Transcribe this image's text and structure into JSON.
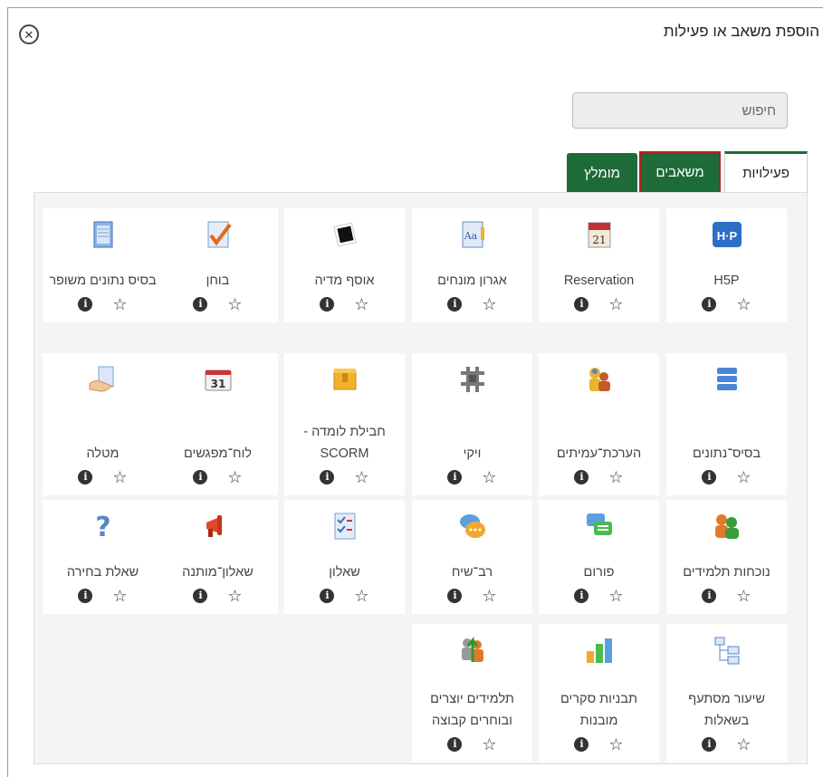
{
  "dialog": {
    "title": "הוספת משאב או פעילות",
    "close_glyph": "✕"
  },
  "search": {
    "placeholder": "חיפוש"
  },
  "tabs": [
    {
      "label": "פעילויות",
      "active": true
    },
    {
      "label": "משאבים",
      "highlighted": true
    },
    {
      "label": "מומלץ"
    }
  ],
  "items": [
    {
      "label": "H5P",
      "icon": "h5p-icon"
    },
    {
      "label": "Reservation",
      "icon": "calendar-page-icon"
    },
    {
      "label": "אגרון מונחים",
      "icon": "glossary-icon"
    },
    {
      "label": "אוסף מדיה",
      "icon": "media-collection-icon"
    },
    {
      "label": "בוחן",
      "icon": "quiz-checkmark-icon"
    },
    {
      "label": "בסיס נתונים משופר",
      "icon": "document-icon"
    },
    {
      "label": "בסיס־נתונים",
      "icon": "database-icon"
    },
    {
      "label": "הערכת־עמיתים",
      "icon": "peer-assessment-icon"
    },
    {
      "label": "ויקי",
      "icon": "wiki-icon"
    },
    {
      "label": "חבילת לומדה - SCORM",
      "icon": "scorm-package-icon"
    },
    {
      "label": "לוח־מפגשים",
      "icon": "scheduler-calendar-icon"
    },
    {
      "label": "מטלה",
      "icon": "assignment-icon"
    },
    {
      "label": "נוכחות תלמידים",
      "icon": "attendance-icon"
    },
    {
      "label": "פורום",
      "icon": "forum-icon"
    },
    {
      "label": "רב־שיח",
      "icon": "chat-icon"
    },
    {
      "label": "שאלון",
      "icon": "questionnaire-icon"
    },
    {
      "label": "שאלון־מותנה",
      "icon": "megaphone-icon"
    },
    {
      "label": "שאלת בחירה",
      "icon": "question-mark-icon"
    },
    {
      "label": "שיעור מסתעף בשאלות",
      "icon": "lesson-icon"
    },
    {
      "label": "תבניות סקרים מובנות",
      "icon": "survey-chart-icon"
    },
    {
      "label": "תלמידים יוצרים ובוחרים קבוצה",
      "icon": "group-choice-icon"
    }
  ],
  "action_icons": {
    "info": "info-icon",
    "star": "star-icon",
    "info_glyph": "i",
    "star_glyph": "☆"
  },
  "colors": {
    "tab_green": "#1e6b3a",
    "highlight_red": "#b81f1f"
  }
}
